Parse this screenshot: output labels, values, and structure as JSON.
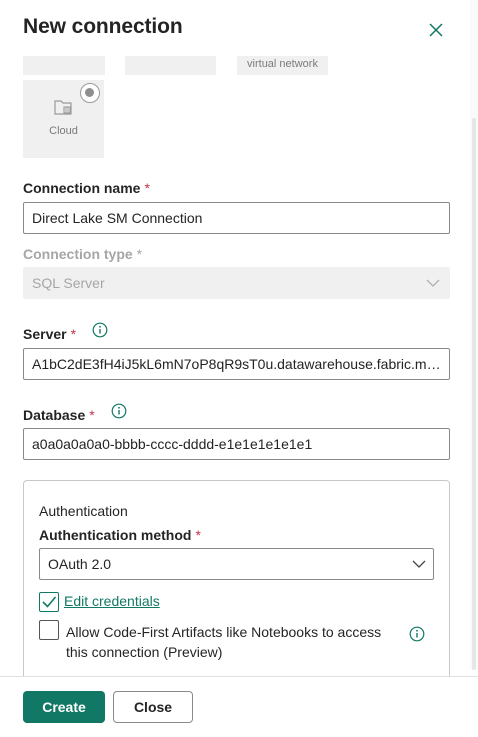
{
  "header": {
    "title": "New connection",
    "close_icon": "close-icon"
  },
  "gateway_options": {
    "virtual_network_caption": "virtual network",
    "cloud_caption": "Cloud",
    "cloud_selected": true
  },
  "connection_name": {
    "label": "Connection name",
    "required": "*",
    "value": "Direct Lake SM Connection"
  },
  "connection_type": {
    "label": "Connection type",
    "required": "*",
    "value": "SQL Server"
  },
  "server": {
    "label": "Server",
    "required": "*",
    "value": "A1bC2dE3fH4iJ5kL6mN7oP8qR9sT0u.datawarehouse.fabric.mi..."
  },
  "database": {
    "label": "Database",
    "required": "*",
    "value": "a0a0a0a0a0-bbbb-cccc-dddd-e1e1e1e1e1e1"
  },
  "authentication": {
    "section_title": "Authentication",
    "method_label": "Authentication method",
    "required": "*",
    "method_value": "OAuth 2.0",
    "edit_credentials": "Edit credentials",
    "edit_credentials_checked": true,
    "allow_code_first_label": "Allow Code-First Artifacts like Notebooks to access this connection (Preview)",
    "allow_code_first_checked": false
  },
  "footer": {
    "create_label": "Create",
    "close_label": "Close"
  },
  "colors": {
    "accent": "#117865",
    "required": "#c4314b",
    "disabled_text": "#a6a6a6"
  }
}
